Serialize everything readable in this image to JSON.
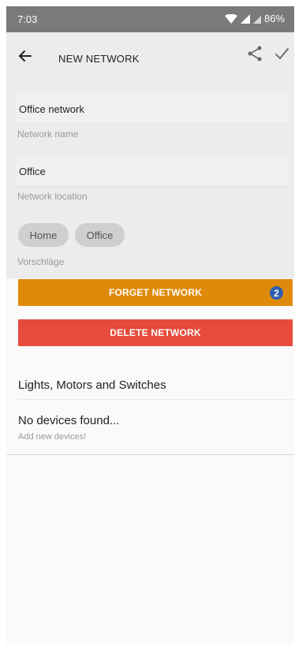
{
  "status_bar": {
    "time": "7:03",
    "battery": "86%"
  },
  "toolbar": {
    "title": "NEW NETWORK"
  },
  "form": {
    "name_value": "Office network",
    "name_label": "Network name",
    "location_value": "Office",
    "location_label": "Network location",
    "suggestions": [
      "Home",
      "Office"
    ],
    "suggestions_label": "Vorschläge"
  },
  "buttons": {
    "forget_label": "FORGET NETWORK",
    "forget_badge": "2",
    "delete_label": "DELETE NETWORK"
  },
  "devices": {
    "section_title": "Lights, Motors and Switches",
    "empty_title": "No devices found...",
    "empty_subtitle": "Add new devices!"
  },
  "colors": {
    "status_bar": "#7a7a7a",
    "form_background": "#ececec",
    "forget_button": "#e08a0b",
    "delete_button": "#e64b3c",
    "badge": "#2d5fb0"
  },
  "icons": {
    "back": "arrow-left-icon",
    "share": "share-icon",
    "confirm": "check-icon",
    "wifi": "wifi-icon",
    "signal": "signal-icon",
    "signal_secondary": "signal-secondary-icon"
  }
}
